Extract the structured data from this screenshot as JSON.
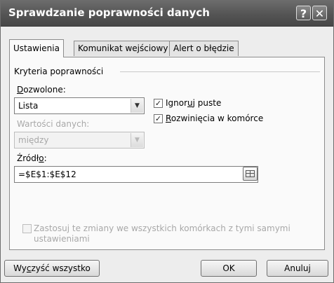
{
  "dialog": {
    "title": "Sprawdzanie poprawności danych",
    "help_glyph": "?",
    "close_glyph": "✕"
  },
  "tabs": [
    {
      "label": "Ustawienia",
      "active": true
    },
    {
      "label": "Komunikat wejściowy",
      "active": false
    },
    {
      "label": "Alert o błędzie",
      "active": false
    }
  ],
  "criteria": {
    "group_label": "Kryteria poprawności",
    "allow_label_pre": "",
    "allow_label_ul": "D",
    "allow_label_post": "ozwolone:",
    "allow_value": "Lista",
    "data_label": "Wartości danych:",
    "data_value": "między",
    "ignore_blank_pre": "Ignor",
    "ignore_blank_ul": "u",
    "ignore_blank_post": "j puste",
    "ignore_blank_checked": true,
    "dropdown_pre": "",
    "dropdown_ul": "R",
    "dropdown_post": "ozwinięcia w komórce",
    "dropdown_checked": true,
    "source_label_pre": "Źródł",
    "source_label_ul": "o",
    "source_label_post": ":",
    "source_value": "=$E$1:$E$12",
    "apply_text_line1": "Zastosuj te zmiany we wszystkich komórkach z tymi samymi",
    "apply_text_line2": "ustawieniami",
    "apply_checked": false
  },
  "buttons": {
    "clear_pre": "Wy",
    "clear_ul": "c",
    "clear_post": "zyść wszystko",
    "ok": "OK",
    "cancel": "Anuluj"
  },
  "icons": {
    "checkmark": "✓",
    "dropdown_arrow": "▼"
  }
}
